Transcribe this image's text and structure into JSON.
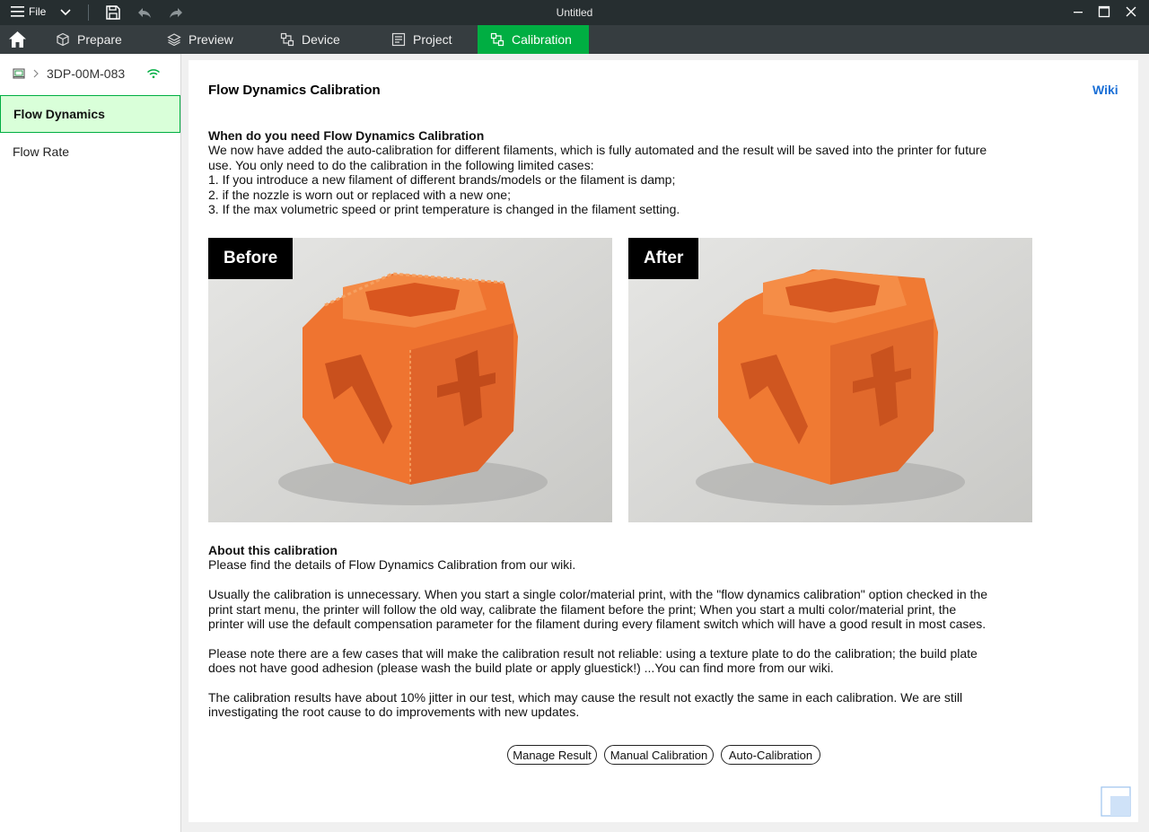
{
  "titlebar": {
    "menu_label": "File",
    "window_title": "Untitled"
  },
  "tabs": [
    {
      "label": "Prepare",
      "icon": "cube-icon"
    },
    {
      "label": "Preview",
      "icon": "layers-icon"
    },
    {
      "label": "Device",
      "icon": "device-icon"
    },
    {
      "label": "Project",
      "icon": "project-icon"
    },
    {
      "label": "Calibration",
      "icon": "calibration-icon",
      "active": true
    }
  ],
  "sidebar": {
    "device_name": "3DP-00M-083",
    "items": [
      {
        "label": "Flow Dynamics",
        "active": true
      },
      {
        "label": "Flow Rate",
        "active": false
      }
    ]
  },
  "main": {
    "title": "Flow Dynamics Calibration",
    "wiki_label": "Wiki",
    "when_heading": "When do you need Flow Dynamics Calibration",
    "when_lines": [
      "We now have added the auto-calibration for different filaments, which is fully automated and the result will be saved into the printer for future",
      "use. You only need to do the calibration in the following limited cases:",
      "1. If you introduce a new filament of different brands/models or the filament is damp;",
      "2. if the nozzle is worn out or replaced with a new one;",
      "3. If the max volumetric speed or print temperature is changed in the filament setting."
    ],
    "before_label": "Before",
    "after_label": "After",
    "about_heading": "About this calibration",
    "about_line": "Please find the details of Flow Dynamics Calibration from our wiki.",
    "para1": [
      "Usually the calibration is unnecessary. When you start a single color/material print, with the \"flow dynamics calibration\" option checked in the",
      "print start menu, the printer will follow the old way, calibrate the filament before the print; When you start a multi color/material print, the",
      "printer will use the default compensation parameter for the filament during every filament switch which will have a good result in most cases."
    ],
    "para2": [
      "Please note there are a few cases that will make the calibration result not reliable: using a texture plate to do the calibration; the build plate",
      "does not have good adhesion (please wash the build plate or apply gluestick!) ...You can find more from our wiki."
    ],
    "para3": [
      "The calibration results have about 10% jitter in our test, which may cause the result not exactly the same in each calibration. We are still",
      "investigating the root cause to do improvements with new updates."
    ],
    "buttons": {
      "manage": "Manage Result",
      "manual": "Manual Calibration",
      "auto": "Auto-Calibration"
    }
  },
  "colors": {
    "accent": "#00ae42",
    "active_bg": "#d9ffd9",
    "link": "#1a6fd6",
    "print_orange": "#f07a33"
  }
}
